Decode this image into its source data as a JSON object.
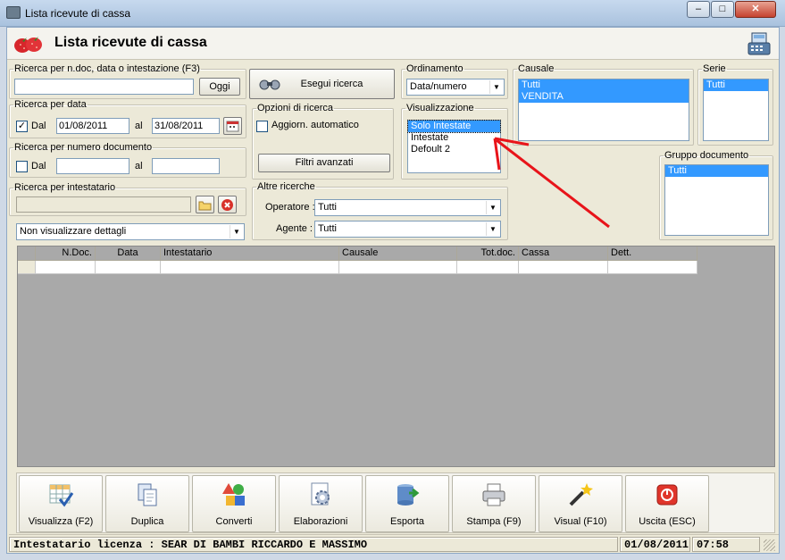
{
  "window": {
    "title": "Lista ricevute di cassa",
    "controls": {
      "minimize": "–",
      "maximize": "□",
      "close": "✕"
    }
  },
  "header": {
    "title": "Lista ricevute di cassa"
  },
  "search_ndoc": {
    "legend": "Ricerca per n.doc, data o intestazione (F3)",
    "value": "",
    "oggi_label": "Oggi"
  },
  "search_data": {
    "legend": "Ricerca per data",
    "enabled": true,
    "dal_label": "Dal",
    "dal_value": "01/08/2011",
    "al_label": "al",
    "al_value": "31/08/2011"
  },
  "search_numero": {
    "legend": "Ricerca per numero documento",
    "enabled": false,
    "dal_label": "Dal",
    "dal_value": "",
    "al_label": "al",
    "al_value": ""
  },
  "search_intestatario": {
    "legend": "Ricerca per intestatario",
    "value": ""
  },
  "dettagli": {
    "selected": "Non visualizzare dettagli"
  },
  "esegui": {
    "label": "Esegui ricerca"
  },
  "opzioni": {
    "legend": "Opzioni di ricerca",
    "aggiorn_label": "Aggiorn. automatico",
    "aggiorn_checked": false,
    "filtri_label": "Filtri avanzati"
  },
  "altre": {
    "legend": "Altre ricerche",
    "operatore_label": "Operatore :",
    "operatore_value": "Tutti",
    "agente_label": "Agente :",
    "agente_value": "Tutti"
  },
  "ordinamento": {
    "legend": "Ordinamento",
    "selected": "Data/numero"
  },
  "visualizzazione": {
    "legend": "Visualizzazione",
    "items": [
      "Solo Intestate",
      "Intestate",
      "Defoult 2"
    ],
    "selected_index": 0
  },
  "causale": {
    "legend": "Causale",
    "items": [
      "Tutti",
      "VENDITA"
    ]
  },
  "serie": {
    "legend": "Serie",
    "items": [
      "Tutti"
    ]
  },
  "gruppo": {
    "legend": "Gruppo documento",
    "items": [
      "Tutti"
    ]
  },
  "grid": {
    "columns": [
      "",
      "N.Doc.",
      "Data",
      "Intestatario",
      "Causale",
      "Tot.doc.",
      "Cassa",
      "Dett."
    ]
  },
  "toolbar": {
    "buttons": [
      {
        "label": "Visualizza (F2)",
        "icon": "grid-check-icon"
      },
      {
        "label": "Duplica",
        "icon": "duplicate-icon"
      },
      {
        "label": "Converti",
        "icon": "convert-shapes-icon"
      },
      {
        "label": "Elaborazioni",
        "icon": "gear-document-icon"
      },
      {
        "label": "Esporta",
        "icon": "export-database-icon"
      },
      {
        "label": "Stampa (F9)",
        "icon": "printer-icon"
      },
      {
        "label": "Visual (F10)",
        "icon": "magic-wand-icon"
      },
      {
        "label": "Uscita (ESC)",
        "icon": "power-icon"
      }
    ]
  },
  "status": {
    "license": "Intestatario licenza : SEAR DI BAMBI RICCARDO E MASSIMO",
    "date": "01/08/2011",
    "time": "07:58"
  },
  "colors": {
    "selection": "#3399ff",
    "annotation_arrow": "#e8141a",
    "grid_background": "#a9a9a9"
  }
}
